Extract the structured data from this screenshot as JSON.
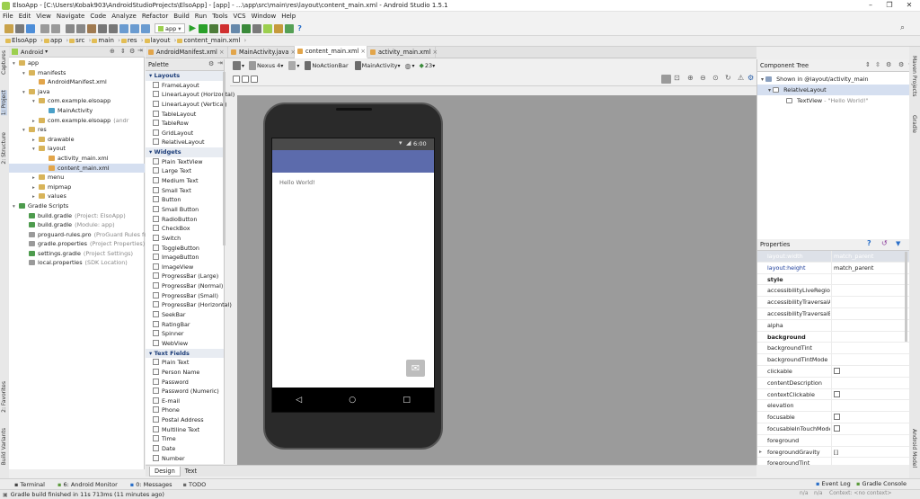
{
  "window": {
    "title": "ElsoApp - [C:\\Users\\Kobak903\\AndroidStudioProjects\\ElsoApp] - [app] - ...\\app\\src\\main\\res\\layout\\content_main.xml - Android Studio 1.5.1",
    "minimize": "–",
    "maximize": "❐",
    "close": "✕"
  },
  "menu": [
    "File",
    "Edit",
    "View",
    "Navigate",
    "Code",
    "Analyze",
    "Refactor",
    "Build",
    "Run",
    "Tools",
    "VCS",
    "Window",
    "Help"
  ],
  "toolbar": {
    "run_config": "app",
    "help": "?"
  },
  "breadcrumb": [
    "ElsoApp",
    "app",
    "src",
    "main",
    "res",
    "layout",
    "content_main.xml"
  ],
  "left_strip": {
    "captures": "Captures",
    "project": "1: Project",
    "structure": "2: Structure",
    "favorites": "2: Favorites",
    "build_variants": "Build Variants"
  },
  "project": {
    "view": "Android",
    "tree": [
      {
        "label": "app",
        "depth": 0,
        "icon": "folder",
        "expanded": true
      },
      {
        "label": "manifests",
        "depth": 1,
        "icon": "folder",
        "expanded": true
      },
      {
        "label": "AndroidManifest.xml",
        "depth": 2,
        "icon": "xml"
      },
      {
        "label": "java",
        "depth": 1,
        "icon": "folder",
        "expanded": true
      },
      {
        "label": "com.example.elsoapp",
        "depth": 2,
        "icon": "package",
        "expanded": true
      },
      {
        "label": "MainActivity",
        "depth": 3,
        "icon": "class"
      },
      {
        "label": "com.example.elsoapp",
        "depth": 2,
        "icon": "package",
        "suffix": "(andr"
      },
      {
        "label": "res",
        "depth": 1,
        "icon": "folder",
        "expanded": true
      },
      {
        "label": "drawable",
        "depth": 2,
        "icon": "folder"
      },
      {
        "label": "layout",
        "depth": 2,
        "icon": "folder",
        "expanded": true
      },
      {
        "label": "activity_main.xml",
        "depth": 3,
        "icon": "layout"
      },
      {
        "label": "content_main.xml",
        "depth": 3,
        "icon": "layout",
        "selected": true
      },
      {
        "label": "menu",
        "depth": 2,
        "icon": "folder"
      },
      {
        "label": "mipmap",
        "depth": 2,
        "icon": "folder"
      },
      {
        "label": "values",
        "depth": 2,
        "icon": "folder"
      },
      {
        "label": "Gradle Scripts",
        "depth": 0,
        "icon": "gradle",
        "expanded": true
      },
      {
        "label": "build.gradle",
        "depth": 1,
        "icon": "gradle",
        "suffix": "(Project: ElsoApp)"
      },
      {
        "label": "build.gradle",
        "depth": 1,
        "icon": "gradle",
        "suffix": "(Module: app)"
      },
      {
        "label": "proguard-rules.pro",
        "depth": 1,
        "icon": "file",
        "suffix": "(ProGuard Rules for ap"
      },
      {
        "label": "gradle.properties",
        "depth": 1,
        "icon": "file",
        "suffix": "(Project Properties)"
      },
      {
        "label": "settings.gradle",
        "depth": 1,
        "icon": "gradle",
        "suffix": "(Project Settings)"
      },
      {
        "label": "local.properties",
        "depth": 1,
        "icon": "file",
        "suffix": "(SDK Location)"
      }
    ]
  },
  "tabs": [
    {
      "label": "AndroidManifest.xml",
      "active": false
    },
    {
      "label": "MainActivity.java",
      "active": false
    },
    {
      "label": "content_main.xml",
      "active": true
    },
    {
      "label": "activity_main.xml",
      "active": false
    }
  ],
  "palette": {
    "title": "Palette",
    "groups": [
      {
        "name": "Layouts",
        "items": [
          "FrameLayout",
          "LinearLayout (Horizontal)",
          "LinearLayout (Vertical)",
          "TableLayout",
          "TableRow",
          "GridLayout",
          "RelativeLayout"
        ]
      },
      {
        "name": "Widgets",
        "items": [
          "Plain TextView",
          "Large Text",
          "Medium Text",
          "Small Text",
          "Button",
          "Small Button",
          "RadioButton",
          "CheckBox",
          "Switch",
          "ToggleButton",
          "ImageButton",
          "ImageView",
          "ProgressBar (Large)",
          "ProgressBar (Normal)",
          "ProgressBar (Small)",
          "ProgressBar (Horizontal)",
          "SeekBar",
          "RatingBar",
          "Spinner",
          "WebView"
        ]
      },
      {
        "name": "Text Fields",
        "items": [
          "Plain Text",
          "Person Name",
          "Password",
          "Password (Numeric)",
          "E-mail",
          "Phone",
          "Postal Address",
          "Multiline Text",
          "Time",
          "Date",
          "Number"
        ]
      }
    ]
  },
  "design_toolbar": {
    "device": "Nexus 4",
    "theme": "NoActionBar",
    "activity": "MainActivity",
    "api": "23"
  },
  "phone": {
    "time": "6:00",
    "hello": "Hello World!"
  },
  "component_tree": {
    "title": "Component Tree",
    "items": [
      {
        "label": "Shown in @layout/activity_main",
        "depth": 0
      },
      {
        "label": "RelativeLayout",
        "depth": 1,
        "selected": true
      },
      {
        "label": "TextView",
        "suffix": "- \"Hello World!\"",
        "depth": 2
      }
    ]
  },
  "properties": {
    "title": "Properties",
    "rows": [
      {
        "name": "layout:width",
        "value": "match_parent",
        "style": "header"
      },
      {
        "name": "layout:height",
        "value": "match_parent",
        "style": "blue"
      },
      {
        "name": "style",
        "value": "",
        "style": "bold"
      },
      {
        "name": "accessibilityLiveRegion",
        "value": ""
      },
      {
        "name": "accessibilityTraversalAfte",
        "value": ""
      },
      {
        "name": "accessibilityTraversalBefo",
        "value": ""
      },
      {
        "name": "alpha",
        "value": ""
      },
      {
        "name": "background",
        "value": "",
        "style": "bold"
      },
      {
        "name": "backgroundTint",
        "value": ""
      },
      {
        "name": "backgroundTintMode",
        "value": ""
      },
      {
        "name": "clickable",
        "value": "",
        "checkbox": true
      },
      {
        "name": "contentDescription",
        "value": ""
      },
      {
        "name": "contextClickable",
        "value": "",
        "checkbox": true
      },
      {
        "name": "elevation",
        "value": ""
      },
      {
        "name": "focusable",
        "value": "",
        "checkbox": true
      },
      {
        "name": "focusableInTouchMode",
        "value": "",
        "checkbox": true
      },
      {
        "name": "foreground",
        "value": ""
      },
      {
        "name": "foregroundGravity",
        "value": "[]",
        "expand": true
      },
      {
        "name": "foregroundTint",
        "value": ""
      }
    ]
  },
  "design_tabs": [
    "Design",
    "Text"
  ],
  "right_strip": {
    "maven": "Maven Projects",
    "gradle": "Gradle",
    "device": "Android Model"
  },
  "tool_windows": {
    "left": [
      {
        "label": "Terminal"
      },
      {
        "label": "6: Android Monitor"
      },
      {
        "label": "0: Messages"
      },
      {
        "label": "TODO"
      }
    ],
    "right": [
      {
        "label": "Event Log"
      },
      {
        "label": "Gradle Console"
      }
    ]
  },
  "status": {
    "message": "Gradle build finished in 11s 713ms (11 minutes ago)",
    "pos1": "n/a",
    "pos2": "n/a",
    "context": "Context: <no context>"
  },
  "colors": {
    "appbar": "#5c6bac",
    "statusbar": "#4a4a4a",
    "navbar": "#000000"
  }
}
